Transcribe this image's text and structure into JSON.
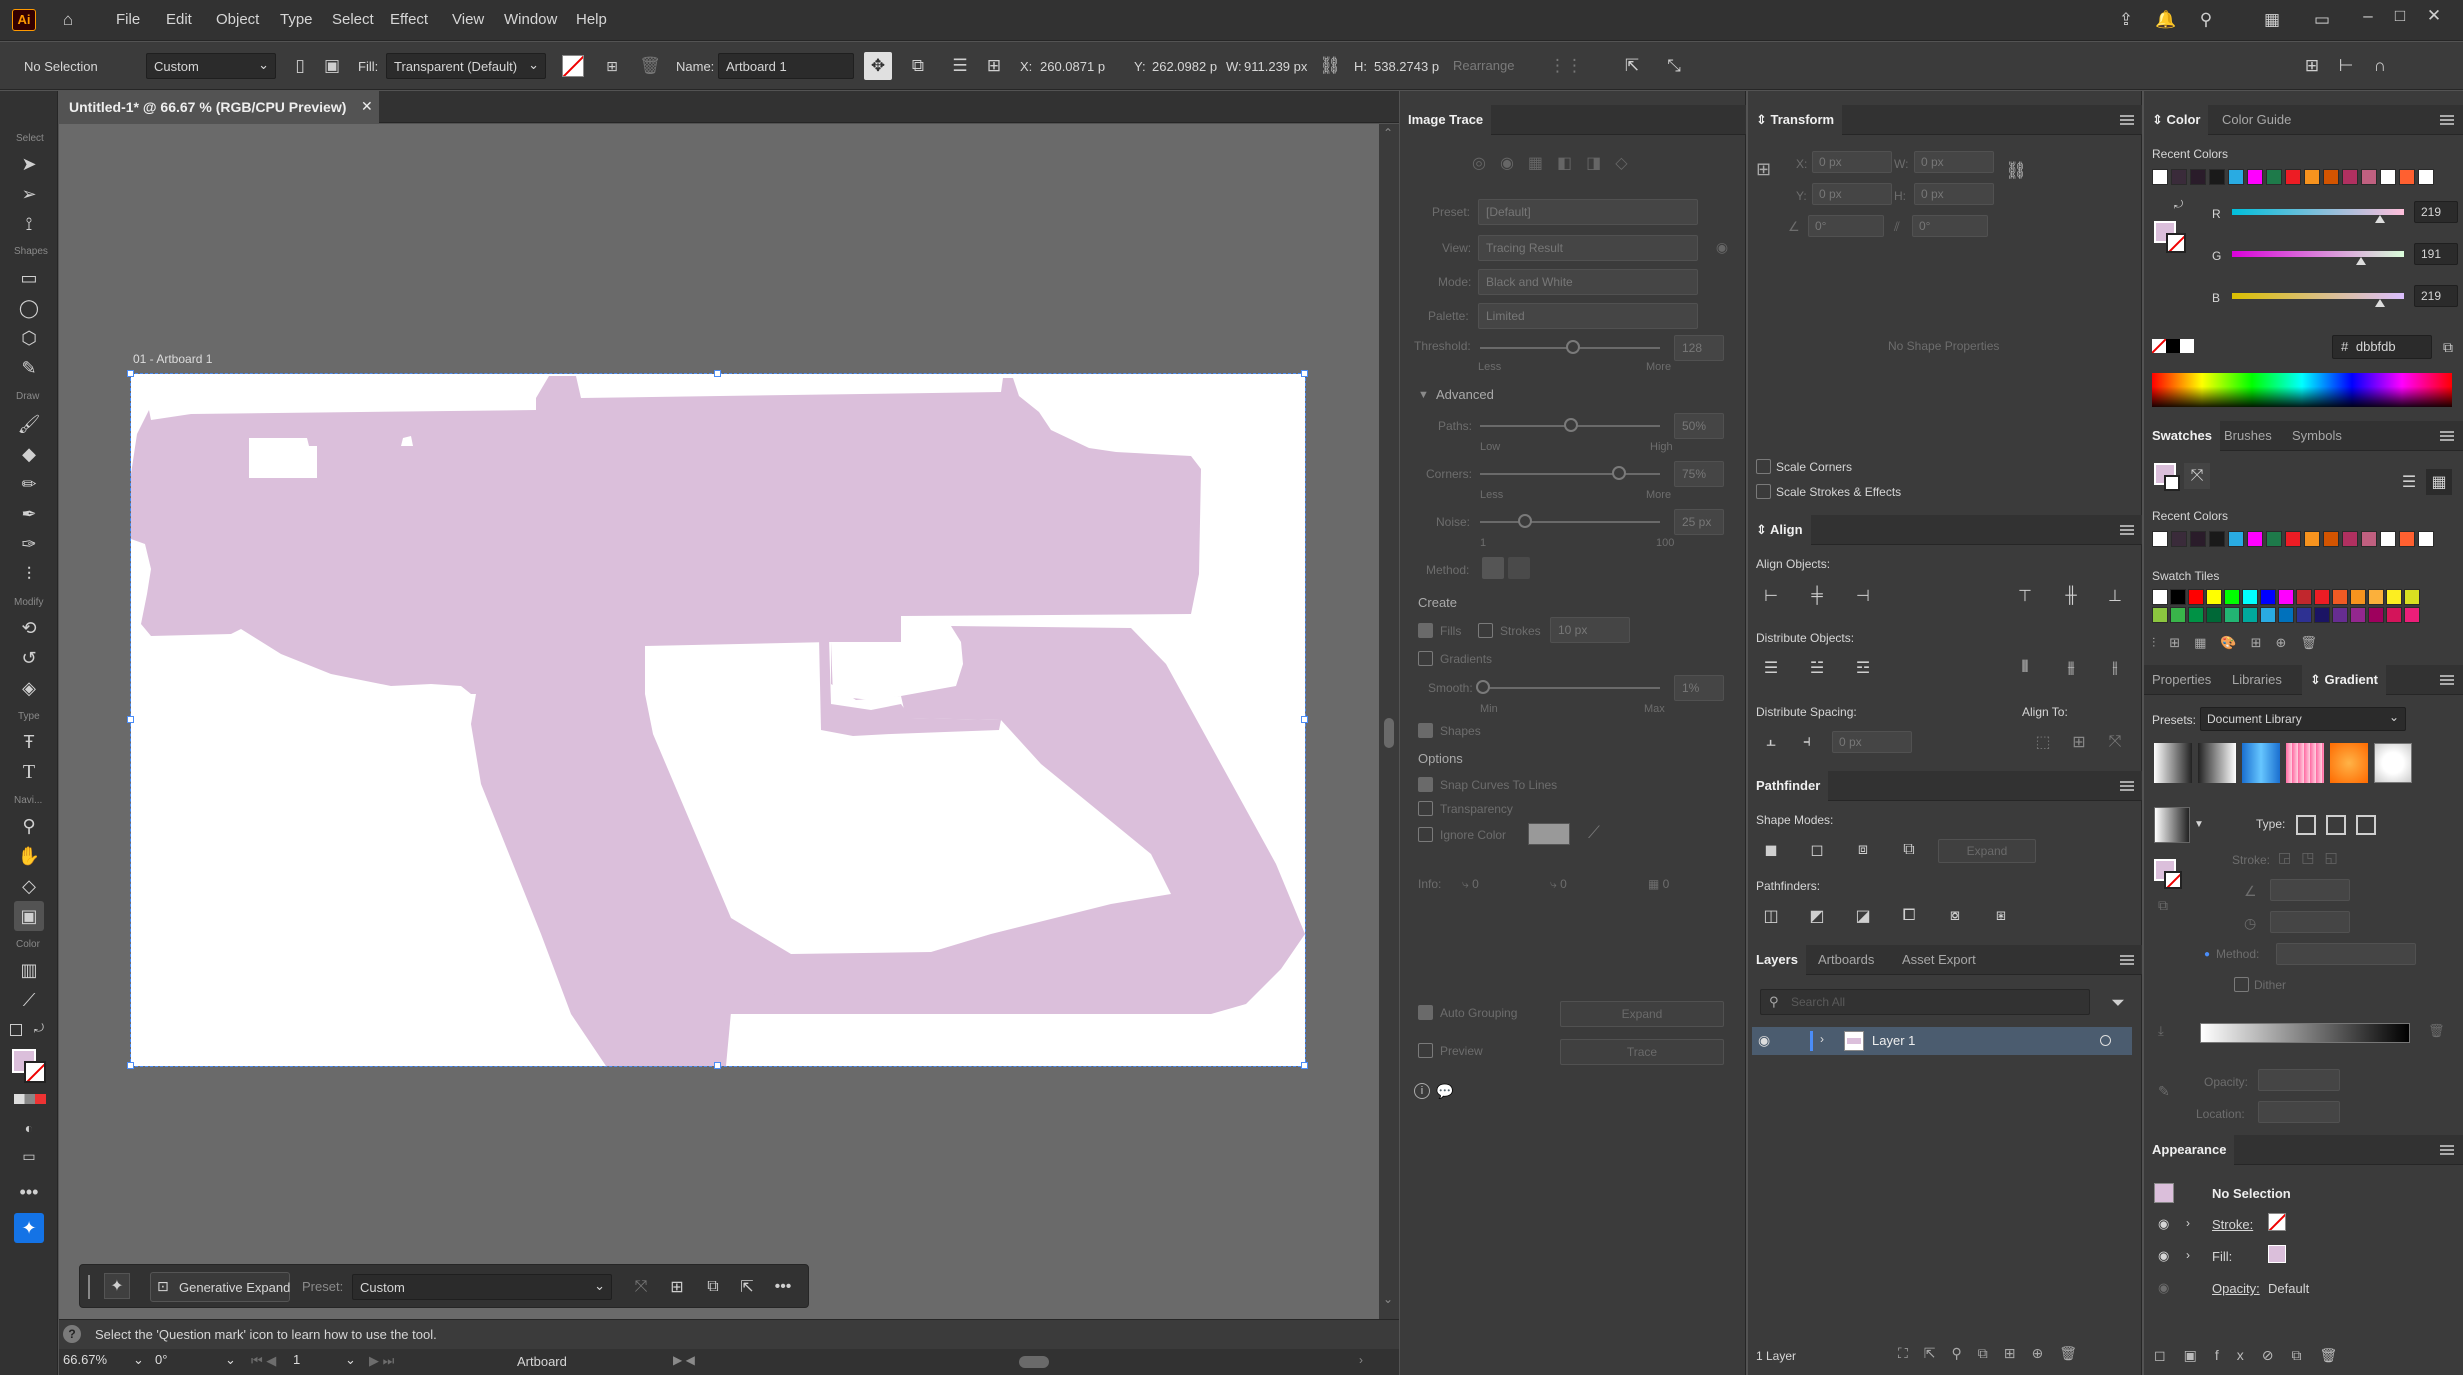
{
  "app": {
    "logo": "Ai",
    "menu": [
      "File",
      "Edit",
      "Object",
      "Type",
      "Select",
      "Effect",
      "View",
      "Window",
      "Help"
    ]
  },
  "control_bar": {
    "selection": "No Selection",
    "preset": "Custom",
    "fill_label": "Fill:",
    "fill_value": "Transparent (Default)",
    "name_label": "Name:",
    "name_value": "Artboard 1",
    "x_label": "X:",
    "x_value": "260.0871 p",
    "y_label": "Y:",
    "y_value": "262.0982 p",
    "w_label": "W:",
    "w_value": "911.239 px",
    "h_label": "H:",
    "h_value": "538.2743 p",
    "rearrange": "Rearrange"
  },
  "document": {
    "tab_title": "Untitled-1* @ 66.67 % (RGB/CPU Preview)",
    "artboard_label": "01 - Artboard 1",
    "silhouette_color": "#dbbfdb"
  },
  "toolbar": {
    "groups": [
      "Select",
      "Shapes",
      "Draw",
      "Modify",
      "Type",
      "Navi...",
      "Color"
    ]
  },
  "context_bar": {
    "gen_expand": "Generative Expand",
    "preset_label": "Preset:",
    "preset_value": "Custom"
  },
  "status": {
    "hint": "Select the 'Question mark' icon to learn how to use the tool.",
    "zoom": "66.67%",
    "rotation": "0°",
    "artboard_num": "1",
    "mode": "Artboard"
  },
  "image_trace": {
    "title": "Image Trace",
    "preset_label": "Preset:",
    "preset_value": "[Default]",
    "view_label": "View:",
    "view_value": "Tracing Result",
    "mode_label": "Mode:",
    "mode_value": "Black and White",
    "palette_label": "Palette:",
    "palette_value": "Limited",
    "threshold_label": "Threshold:",
    "threshold_value": "128",
    "less": "Less",
    "more": "More",
    "advanced": "Advanced",
    "paths_label": "Paths:",
    "paths_value": "50%",
    "low": "Low",
    "high": "High",
    "corners_label": "Corners:",
    "corners_value": "75%",
    "noise_label": "Noise:",
    "noise_value": "25 px",
    "noise_min": "1",
    "noise_max": "100",
    "method_label": "Method:",
    "create": "Create",
    "fills": "Fills",
    "strokes": "Strokes",
    "stroke_px": "10 px",
    "gradients": "Gradients",
    "smooth_label": "Smooth:",
    "smooth_value": "1%",
    "min": "Min",
    "max": "Max",
    "shapes": "Shapes",
    "options": "Options",
    "snap": "Snap Curves To Lines",
    "transparency": "Transparency",
    "ignore_color": "Ignore Color",
    "info_label": "Info:",
    "info_a": "0",
    "info_b": "0",
    "info_c": "0",
    "auto_grouping": "Auto Grouping",
    "expand": "Expand",
    "preview": "Preview",
    "trace": "Trace"
  },
  "transform": {
    "title": "Transform",
    "x_label": "X:",
    "x_value": "0 px",
    "y_label": "Y:",
    "y_value": "0 px",
    "w_label": "W:",
    "w_value": "0 px",
    "h_label": "H:",
    "h_value": "0 px",
    "angle": "0°",
    "shear": "0°",
    "no_props": "No Shape Properties",
    "scale_corners": "Scale Corners",
    "scale_strokes": "Scale Strokes & Effects"
  },
  "align": {
    "title": "Align",
    "align_objects": "Align Objects:",
    "distribute_objects": "Distribute Objects:",
    "distribute_spacing": "Distribute Spacing:",
    "align_to": "Align To:",
    "spacing_value": "0 px"
  },
  "pathfinder": {
    "title": "Pathfinder",
    "shape_modes": "Shape Modes:",
    "expand": "Expand",
    "pathfinders": "Pathfinders:"
  },
  "layers": {
    "tabs": [
      "Layers",
      "Artboards",
      "Asset Export"
    ],
    "search_placeholder": "Search All",
    "layer_name": "Layer 1",
    "count": "1 Layer"
  },
  "color": {
    "tabs": [
      "Color",
      "Color Guide"
    ],
    "recent": "Recent Colors",
    "r_label": "R",
    "r_value": "219",
    "g_label": "G",
    "g_value": "191",
    "b_label": "B",
    "b_value": "219",
    "r_level": 0.86,
    "g_level": 0.75,
    "b_level": 0.86,
    "hex_prefix": "#",
    "hex": "dbbfdb",
    "recent_swatches": [
      "#ffffff",
      "#3a2b3a",
      "#2a1c2a",
      "#1a1a1a",
      "#29abe2",
      "#ff00ff",
      "#1e7a4a",
      "#ed1c24",
      "#f7931e",
      "#d35400",
      "#b03060",
      "#c06080",
      "#ffffff",
      "#ff6030",
      "#ffffff"
    ]
  },
  "swatches": {
    "tabs": [
      "Swatches",
      "Brushes",
      "Symbols"
    ],
    "recent": "Recent Colors",
    "tiles": "Swatch Tiles",
    "tile_colors": [
      "#ffffff",
      "#000000",
      "#ff0000",
      "#ffff00",
      "#00ff00",
      "#00ffff",
      "#0000ff",
      "#ff00ff",
      "#c1272d",
      "#ed1c24",
      "#f15a24",
      "#f7931e",
      "#fbb03b",
      "#fcee21",
      "#d9e021",
      "#8cc63f",
      "#39b54a",
      "#009245",
      "#006837",
      "#22b573",
      "#00a99d",
      "#29abe2",
      "#0071bc",
      "#2e3192",
      "#1b1464",
      "#662d91",
      "#93278f",
      "#9e005d",
      "#d4145a",
      "#ed1e79"
    ]
  },
  "gradient": {
    "tabs": [
      "Properties",
      "Libraries",
      "Gradient"
    ],
    "presets_label": "Presets:",
    "presets_value": "Document Library",
    "type_label": "Type:",
    "stroke_label": "Stroke:",
    "method_label": "Method:",
    "dither": "Dither",
    "opacity_label": "Opacity:",
    "location_label": "Location:"
  },
  "appearance": {
    "title": "Appearance",
    "selection": "No Selection",
    "stroke": "Stroke:",
    "fill": "Fill:",
    "opacity": "Opacity:",
    "opacity_value": "Default"
  }
}
